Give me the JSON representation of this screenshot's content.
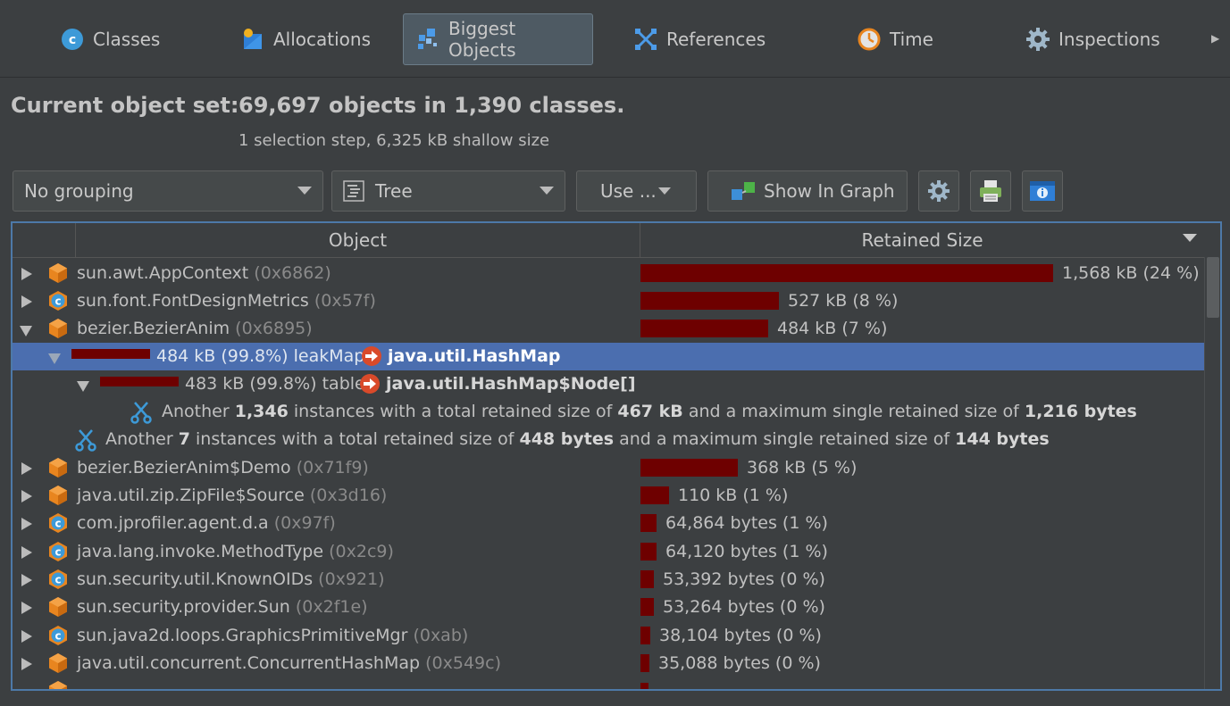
{
  "tabs": [
    {
      "label": "Classes",
      "icon": "class-c-icon"
    },
    {
      "label": "Allocations",
      "icon": "allocations-icon"
    },
    {
      "label": "Biggest Objects",
      "icon": "biggest-objects-icon",
      "active": true
    },
    {
      "label": "References",
      "icon": "references-icon"
    },
    {
      "label": "Time",
      "icon": "clock-icon"
    },
    {
      "label": "Inspections",
      "icon": "gear-icon"
    }
  ],
  "header": {
    "title_label": "Current object set:",
    "title_value": "69,697 objects in 1,390 classes.",
    "subtitle": "1 selection step, 6,325 kB shallow size"
  },
  "toolbar": {
    "grouping": "No grouping",
    "view_mode": "Tree",
    "use_label": "Use ...",
    "show_in_graph": "Show In Graph"
  },
  "table": {
    "col_object": "Object",
    "col_retained": "Retained Size",
    "rows": [
      {
        "name": "sun.awt.AppContext",
        "addr": "(0x6862)",
        "size": "1,568 kB (24 %)",
        "pct": 100,
        "kind": "object"
      },
      {
        "name": "sun.font.FontDesignMetrics",
        "addr": "(0x57f)",
        "size": "527 kB (8 %)",
        "pct": 33.6,
        "kind": "class"
      },
      {
        "name": "bezier.BezierAnim",
        "addr": "(0x6895)",
        "size": "484 kB (7 %)",
        "pct": 30.9,
        "kind": "object"
      },
      {
        "size_prefix": "484 kB (99.8%) leakMap",
        "target": "java.util.HashMap",
        "pct": 99.8
      },
      {
        "size_prefix": "483 kB (99.8%) table",
        "target": "java.util.HashMap$Node[]",
        "pct": 99.8
      },
      {
        "another_prefix": "Another",
        "another_count": "1,346",
        "another_mid": "instances with a total retained size of",
        "another_total": "467 kB",
        "another_mid2": "and a maximum single retained size of",
        "another_max": "1,216 bytes"
      },
      {
        "another_prefix": "Another",
        "another_count": "7",
        "another_mid": "instances with a total retained size of",
        "another_total": "448 bytes",
        "another_mid2": "and a maximum single retained size of",
        "another_max": "144 bytes"
      },
      {
        "name": "bezier.BezierAnim$Demo",
        "addr": "(0x71f9)",
        "size": "368 kB (5 %)",
        "pct": 23.5,
        "kind": "object"
      },
      {
        "name": "java.util.zip.ZipFile$Source",
        "addr": "(0x3d16)",
        "size": "110 kB (1 %)",
        "pct": 7.0,
        "kind": "object"
      },
      {
        "name": "com.jprofiler.agent.d.a",
        "addr": "(0x97f)",
        "size": "64,864 bytes (1 %)",
        "pct": 4.0,
        "kind": "class"
      },
      {
        "name": "java.lang.invoke.MethodType",
        "addr": "(0x2c9)",
        "size": "64,120 bytes (1 %)",
        "pct": 4.0,
        "kind": "class"
      },
      {
        "name": "sun.security.util.KnownOIDs",
        "addr": "(0x921)",
        "size": "53,392 bytes (0 %)",
        "pct": 3.3,
        "kind": "class"
      },
      {
        "name": "sun.security.provider.Sun",
        "addr": "(0x2f1e)",
        "size": "53,264 bytes (0 %)",
        "pct": 3.3,
        "kind": "object"
      },
      {
        "name": "sun.java2d.loops.GraphicsPrimitiveMgr",
        "addr": "(0xab)",
        "size": "38,104 bytes (0 %)",
        "pct": 2.4,
        "kind": "class"
      },
      {
        "name": "java.util.concurrent.ConcurrentHashMap",
        "addr": "(0x549c)",
        "size": "35,088 bytes (0 %)",
        "pct": 2.2,
        "kind": "object"
      }
    ]
  },
  "colors": {
    "bar": "#6e0000",
    "selection": "#4b6eaf",
    "object_icon": "#e8851f",
    "class_icon": "#3d9ad8"
  }
}
